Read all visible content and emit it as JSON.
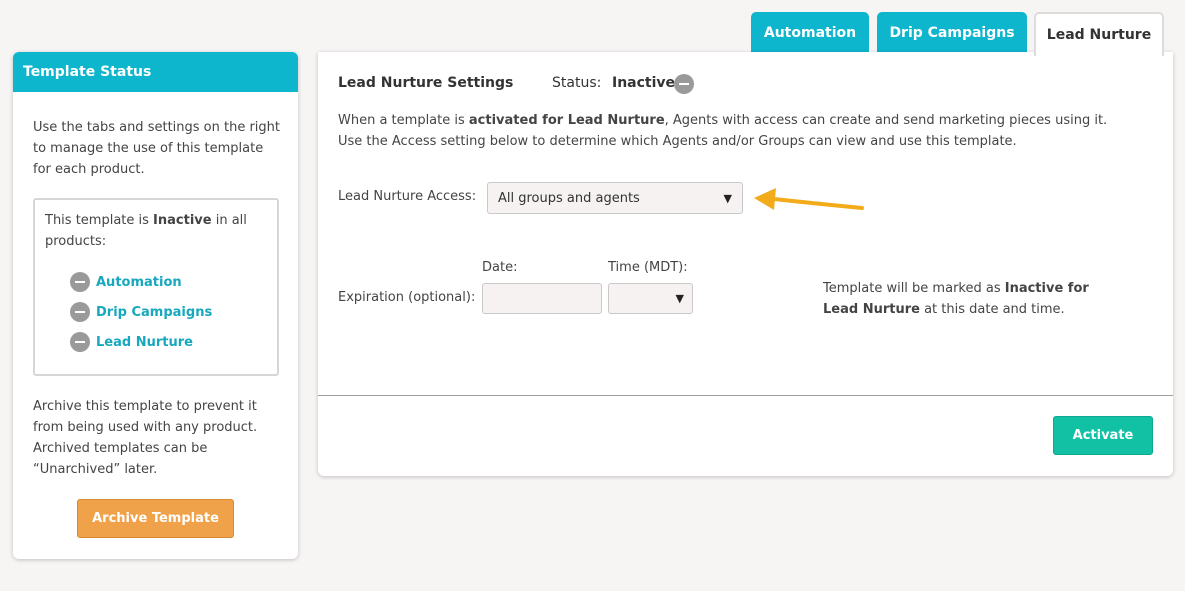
{
  "left_panel": {
    "title": "Template Status",
    "intro": "Use the tabs and settings on the right to manage the use of this template for each product.",
    "status_prefix": "This template is ",
    "status_value": "Inactive",
    "status_suffix": " in all products:",
    "products": [
      {
        "label": "Automation",
        "icon": "minus-circle-icon"
      },
      {
        "label": "Drip Campaigns",
        "icon": "minus-circle-icon"
      },
      {
        "label": "Lead Nurture",
        "icon": "minus-circle-icon"
      }
    ],
    "archive_text": "Archive this template to prevent it from being used with any product. Archived templates can be “Unarchived” later.",
    "archive_button": "Archive Template"
  },
  "tabs": [
    {
      "label": "Automation",
      "active": false
    },
    {
      "label": "Drip Campaigns",
      "active": false
    },
    {
      "label": "Lead Nurture",
      "active": true
    }
  ],
  "main": {
    "title": "Lead Nurture Settings",
    "status_label": "Status:",
    "status_value": "Inactive",
    "desc_part1": "When a template is ",
    "desc_bold": "activated for Lead Nurture",
    "desc_part2": ", Agents with access can create and send marketing pieces using it. Use the Access setting below to determine which Agents and/or Groups can view and use this template.",
    "access_label": "Lead Nurture Access:",
    "access_value": "All groups and agents",
    "date_label": "Date:",
    "time_label": "Time (MDT):",
    "date_value": "",
    "time_value": "",
    "expiration_label": "Expiration (optional):",
    "exp_note_part1": "Template will be marked as ",
    "exp_note_bold": "Inactive for Lead Nurture",
    "exp_note_part2": " at this date and time.",
    "activate_button": "Activate"
  },
  "colors": {
    "accent": "#0db6cd",
    "archive": "#f0a24a",
    "activate": "#12c0a4",
    "arrow": "#f2ac1a",
    "link": "#17a8bd"
  }
}
